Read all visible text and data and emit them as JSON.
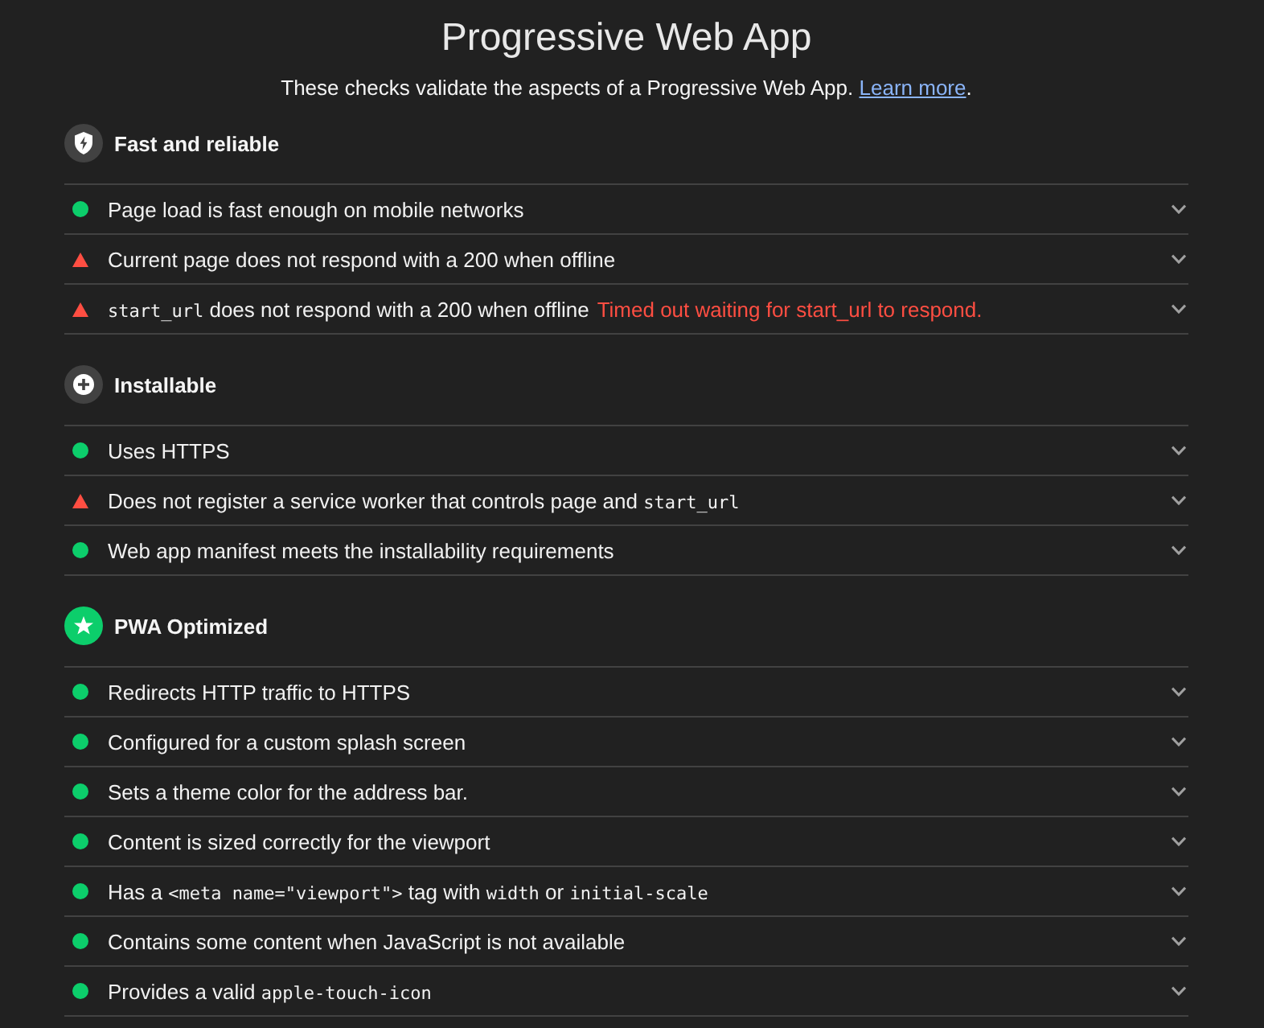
{
  "header": {
    "title": "Progressive Web App",
    "description": "These checks validate the aspects of a Progressive Web App.",
    "link": "Learn more",
    "suffix": "."
  },
  "groups": [
    {
      "title": "Fast and reliable",
      "color": "#424242",
      "audits": [
        {
          "kind": "pass",
          "expanded": false,
          "title_parts": [
            {
              "kind": "text",
              "text": "Page load is fast enough on mobile networks"
            }
          ]
        },
        {
          "kind": "fail",
          "expanded": false,
          "title_parts": [
            {
              "kind": "text",
              "text": "Current page does not respond with a 200 when offline"
            }
          ]
        },
        {
          "kind": "fail",
          "expanded": false,
          "title_parts": [
            {
              "kind": "code",
              "text": "start_url"
            },
            {
              "kind": "text",
              "text": " does not respond with a 200 when offline"
            }
          ],
          "error": "Timed out waiting for start_url to respond."
        }
      ]
    },
    {
      "title": "Installable",
      "color": "#424242",
      "audits": [
        {
          "kind": "pass",
          "expanded": false,
          "title_parts": [
            {
              "kind": "text",
              "text": "Uses HTTPS"
            }
          ]
        },
        {
          "kind": "fail",
          "expanded": false,
          "title_parts": [
            {
              "kind": "text",
              "text": "Does not register a service worker that controls page and "
            },
            {
              "kind": "code",
              "text": "start_url"
            }
          ]
        },
        {
          "kind": "pass",
          "expanded": false,
          "title_parts": [
            {
              "kind": "text",
              "text": "Web app manifest meets the installability requirements"
            }
          ]
        }
      ]
    },
    {
      "title": "PWA Optimized",
      "color": "#0cce6b",
      "audits": [
        {
          "kind": "pass",
          "expanded": false,
          "title_parts": [
            {
              "kind": "text",
              "text": "Redirects HTTP traffic to HTTPS"
            }
          ]
        },
        {
          "kind": "pass",
          "expanded": false,
          "title_parts": [
            {
              "kind": "text",
              "text": "Configured for a custom splash screen"
            }
          ]
        },
        {
          "kind": "pass",
          "expanded": false,
          "title_parts": [
            {
              "kind": "text",
              "text": "Sets a theme color for the address bar."
            }
          ]
        },
        {
          "kind": "pass",
          "expanded": false,
          "title_parts": [
            {
              "kind": "text",
              "text": "Content is sized correctly for the viewport"
            }
          ]
        },
        {
          "kind": "pass",
          "expanded": false,
          "title_parts": [
            {
              "kind": "text",
              "text": "Has a "
            },
            {
              "kind": "code",
              "text": "<meta name=\"viewport\">"
            },
            {
              "kind": "text",
              "text": " tag with "
            },
            {
              "kind": "code",
              "text": "width"
            },
            {
              "kind": "text",
              "text": " or "
            },
            {
              "kind": "code",
              "text": "initial-scale"
            }
          ]
        },
        {
          "kind": "pass",
          "expanded": false,
          "title_parts": [
            {
              "kind": "text",
              "text": "Contains some content when JavaScript is not available"
            }
          ]
        },
        {
          "kind": "pass",
          "expanded": false,
          "title_parts": [
            {
              "kind": "text",
              "text": "Provides a valid "
            },
            {
              "kind": "code",
              "text": "apple-touch-icon"
            }
          ]
        }
      ]
    }
  ]
}
